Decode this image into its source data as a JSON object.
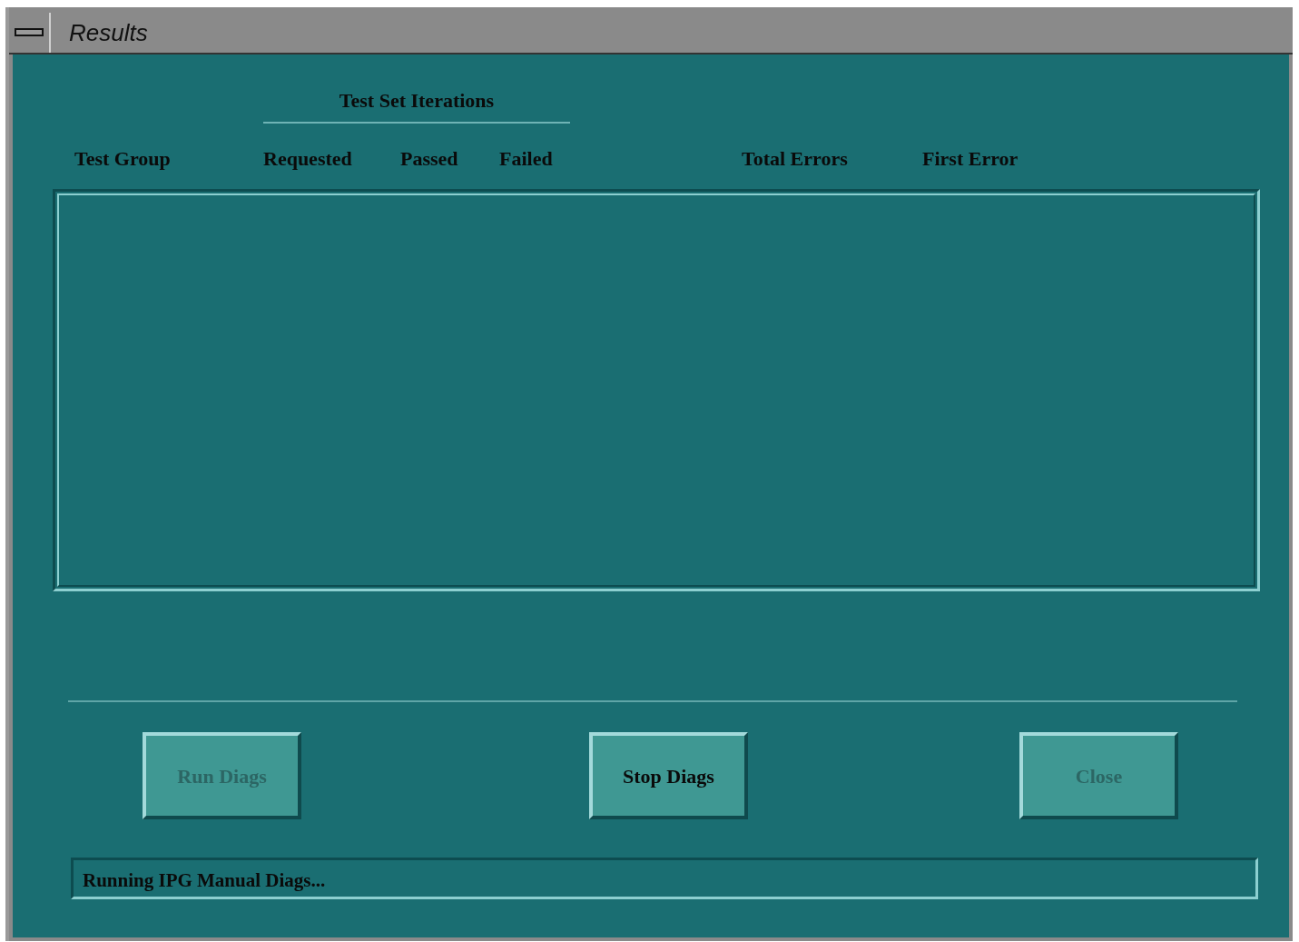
{
  "window": {
    "title": "Results"
  },
  "group_heading": "Test Set Iterations",
  "columns": [
    "Test Group",
    "Requested",
    "Passed",
    "Failed",
    "Total Errors",
    "First Error"
  ],
  "buttons": [
    {
      "label": "Run Diags",
      "disabled": true
    },
    {
      "label": "Stop Diags",
      "disabled": false
    },
    {
      "label": "Close",
      "disabled": true
    }
  ],
  "status_bar": "Running IPG Manual Diags..."
}
